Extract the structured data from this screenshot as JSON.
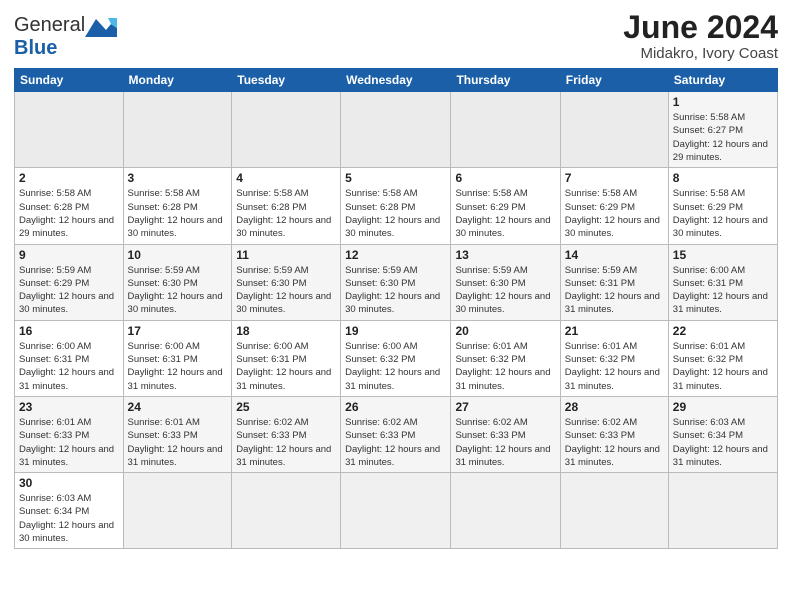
{
  "header": {
    "logo_general": "General",
    "logo_blue": "Blue",
    "title": "June 2024",
    "subtitle": "Midakro, Ivory Coast"
  },
  "days_of_week": [
    "Sunday",
    "Monday",
    "Tuesday",
    "Wednesday",
    "Thursday",
    "Friday",
    "Saturday"
  ],
  "weeks": [
    [
      {
        "day": "",
        "empty": true
      },
      {
        "day": "",
        "empty": true
      },
      {
        "day": "",
        "empty": true
      },
      {
        "day": "",
        "empty": true
      },
      {
        "day": "",
        "empty": true
      },
      {
        "day": "",
        "empty": true
      },
      {
        "day": "1",
        "sunrise": "5:58 AM",
        "sunset": "6:27 PM",
        "daylight": "12 hours and 29 minutes."
      }
    ],
    [
      {
        "day": "2",
        "sunrise": "5:58 AM",
        "sunset": "6:28 PM",
        "daylight": "12 hours and 29 minutes."
      },
      {
        "day": "3",
        "sunrise": "5:58 AM",
        "sunset": "6:28 PM",
        "daylight": "12 hours and 30 minutes."
      },
      {
        "day": "4",
        "sunrise": "5:58 AM",
        "sunset": "6:28 PM",
        "daylight": "12 hours and 30 minutes."
      },
      {
        "day": "5",
        "sunrise": "5:58 AM",
        "sunset": "6:28 PM",
        "daylight": "12 hours and 30 minutes."
      },
      {
        "day": "6",
        "sunrise": "5:58 AM",
        "sunset": "6:29 PM",
        "daylight": "12 hours and 30 minutes."
      },
      {
        "day": "7",
        "sunrise": "5:58 AM",
        "sunset": "6:29 PM",
        "daylight": "12 hours and 30 minutes."
      },
      {
        "day": "8",
        "sunrise": "5:58 AM",
        "sunset": "6:29 PM",
        "daylight": "12 hours and 30 minutes."
      }
    ],
    [
      {
        "day": "9",
        "sunrise": "5:59 AM",
        "sunset": "6:29 PM",
        "daylight": "12 hours and 30 minutes."
      },
      {
        "day": "10",
        "sunrise": "5:59 AM",
        "sunset": "6:30 PM",
        "daylight": "12 hours and 30 minutes."
      },
      {
        "day": "11",
        "sunrise": "5:59 AM",
        "sunset": "6:30 PM",
        "daylight": "12 hours and 30 minutes."
      },
      {
        "day": "12",
        "sunrise": "5:59 AM",
        "sunset": "6:30 PM",
        "daylight": "12 hours and 30 minutes."
      },
      {
        "day": "13",
        "sunrise": "5:59 AM",
        "sunset": "6:30 PM",
        "daylight": "12 hours and 30 minutes."
      },
      {
        "day": "14",
        "sunrise": "5:59 AM",
        "sunset": "6:31 PM",
        "daylight": "12 hours and 31 minutes."
      },
      {
        "day": "15",
        "sunrise": "6:00 AM",
        "sunset": "6:31 PM",
        "daylight": "12 hours and 31 minutes."
      }
    ],
    [
      {
        "day": "16",
        "sunrise": "6:00 AM",
        "sunset": "6:31 PM",
        "daylight": "12 hours and 31 minutes."
      },
      {
        "day": "17",
        "sunrise": "6:00 AM",
        "sunset": "6:31 PM",
        "daylight": "12 hours and 31 minutes."
      },
      {
        "day": "18",
        "sunrise": "6:00 AM",
        "sunset": "6:31 PM",
        "daylight": "12 hours and 31 minutes."
      },
      {
        "day": "19",
        "sunrise": "6:00 AM",
        "sunset": "6:32 PM",
        "daylight": "12 hours and 31 minutes."
      },
      {
        "day": "20",
        "sunrise": "6:01 AM",
        "sunset": "6:32 PM",
        "daylight": "12 hours and 31 minutes."
      },
      {
        "day": "21",
        "sunrise": "6:01 AM",
        "sunset": "6:32 PM",
        "daylight": "12 hours and 31 minutes."
      },
      {
        "day": "22",
        "sunrise": "6:01 AM",
        "sunset": "6:32 PM",
        "daylight": "12 hours and 31 minutes."
      }
    ],
    [
      {
        "day": "23",
        "sunrise": "6:01 AM",
        "sunset": "6:33 PM",
        "daylight": "12 hours and 31 minutes."
      },
      {
        "day": "24",
        "sunrise": "6:01 AM",
        "sunset": "6:33 PM",
        "daylight": "12 hours and 31 minutes."
      },
      {
        "day": "25",
        "sunrise": "6:02 AM",
        "sunset": "6:33 PM",
        "daylight": "12 hours and 31 minutes."
      },
      {
        "day": "26",
        "sunrise": "6:02 AM",
        "sunset": "6:33 PM",
        "daylight": "12 hours and 31 minutes."
      },
      {
        "day": "27",
        "sunrise": "6:02 AM",
        "sunset": "6:33 PM",
        "daylight": "12 hours and 31 minutes."
      },
      {
        "day": "28",
        "sunrise": "6:02 AM",
        "sunset": "6:33 PM",
        "daylight": "12 hours and 31 minutes."
      },
      {
        "day": "29",
        "sunrise": "6:03 AM",
        "sunset": "6:34 PM",
        "daylight": "12 hours and 31 minutes."
      }
    ],
    [
      {
        "day": "30",
        "sunrise": "6:03 AM",
        "sunset": "6:34 PM",
        "daylight": "12 hours and 30 minutes."
      },
      {
        "day": "",
        "empty": true
      },
      {
        "day": "",
        "empty": true
      },
      {
        "day": "",
        "empty": true
      },
      {
        "day": "",
        "empty": true
      },
      {
        "day": "",
        "empty": true
      },
      {
        "day": "",
        "empty": true
      }
    ]
  ]
}
